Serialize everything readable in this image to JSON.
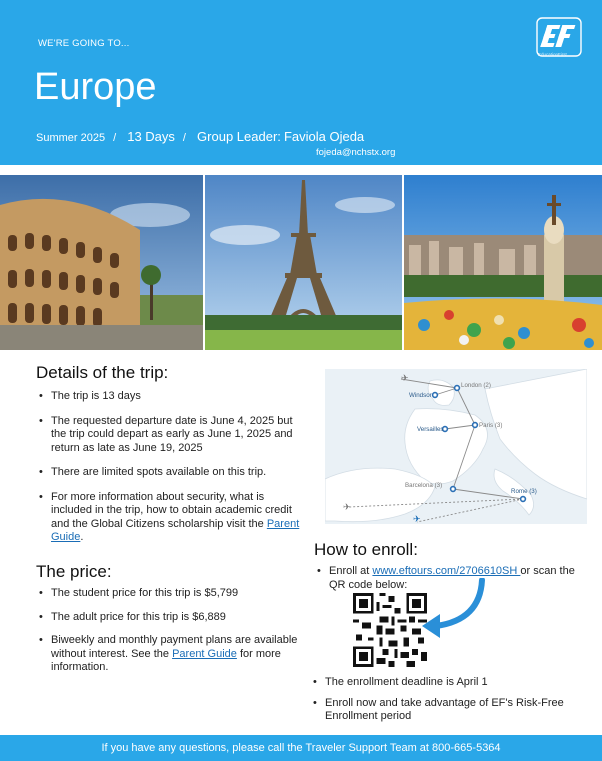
{
  "header": {
    "going_to": "WE'RE GOING TO...",
    "title": "Europe",
    "season": "Summer 2025",
    "sep": "/",
    "days": "13 Days",
    "leader_label": "Group Leader:",
    "leader_name": "Faviola Ojeda",
    "email": "fojeda@nchstx.org",
    "logo_text": "EducationFirst"
  },
  "details": {
    "heading": "Details of the trip:",
    "item1": "The trip is 13  days",
    "item2": "The requested departure date is June 4, 2025 but the trip could depart as early as June 1, 2025 and return as late as June 19, 2025",
    "item3": "There are limited spots available on this trip.",
    "item4_text": "For more information about security, what is included in the trip, how to obtain academic credit and the Global Citizens scholarship visit the ",
    "item4_link": "Parent Guide",
    "item4_end": "."
  },
  "price": {
    "heading": "The price:",
    "item1": "The student price for this trip is $5,799",
    "item2": "The adult price for this trip is $6,889",
    "item3_text": "Biweekly and monthly payment plans are available without interest. See the ",
    "item3_link": "Parent Guide",
    "item3_end": " for more information."
  },
  "map": {
    "cities": [
      "London (2)",
      "Windsor",
      "Paris (3)",
      "Versailles",
      "Barcelona (3)",
      "Rome (3)"
    ]
  },
  "enroll": {
    "heading": "How to enroll:",
    "item1_pre": "Enroll at ",
    "item1_link": "www.eftours.com/2706610SH ",
    "item1_post": " or scan the QR code below:",
    "item2": "The enrollment deadline is April 1",
    "item3": "Enroll now and take advantage of EF's Risk-Free Enrollment period"
  },
  "footer": {
    "text": "If you have any questions, please call the Traveler Support Team at 800-665-5364"
  },
  "colors": {
    "brand_blue": "#2aa7e8",
    "link": "#1a6db6"
  }
}
